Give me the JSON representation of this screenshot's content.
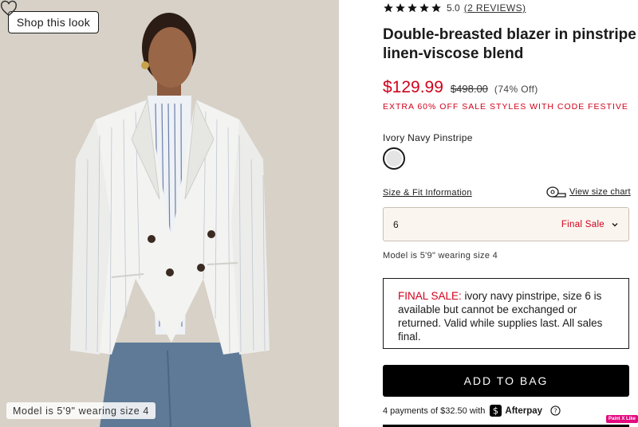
{
  "image_panel": {
    "shop_look_label": "Shop this look",
    "model_caption": "Model is 5'9\" wearing size 4"
  },
  "product": {
    "rating_score": "5.0",
    "reviews_link": "(2 REVIEWS)",
    "rating_stars": 5,
    "title": "Double-breasted blazer in pinstripe linen-viscose blend",
    "sale_price": "$129.99",
    "original_price": "$498.00",
    "percent_off": "(74% Off)",
    "promo_text": "EXTRA 60% OFF SALE STYLES WITH CODE FESTIVE",
    "color_name": "Ivory Navy Pinstripe",
    "size_fit_link": "Size & Fit Information",
    "size_chart_link": "View size chart",
    "selected_size": "6",
    "size_status": "Final Sale",
    "model_note": "Model is 5'9\" wearing size 4",
    "final_sale_label": "FINAL SALE:",
    "final_sale_text": " ivory navy pinstripe, size 6 is available but cannot be exchanged or returned. Valid while supplies last. All sales final.",
    "add_to_bag_label": "ADD TO BAG",
    "afterpay_text": "4 payments of $32.50 with",
    "afterpay_brand": "Afterpay"
  },
  "overlay": {
    "paint_badge": "Paint X Like"
  },
  "colors": {
    "sale_red": "#d0021b",
    "button_black": "#000000",
    "size_select_bg": "#fbf5f0",
    "swatch_ivory": "#e4e4e4"
  },
  "icons": [
    "heart-icon",
    "star-icon",
    "tape-measure-icon",
    "chevron-down-icon",
    "afterpay-icon",
    "help-icon"
  ]
}
